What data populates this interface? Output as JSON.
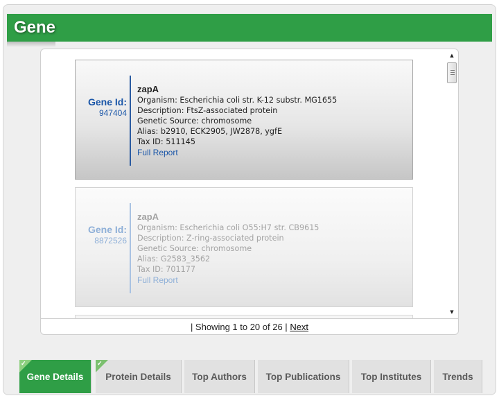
{
  "header": {
    "title": "Gene"
  },
  "results": [
    {
      "id_label": "Gene Id:",
      "id_value": "947404",
      "name": "zapA",
      "organism": "Organism: Escherichia coli str. K-12 substr. MG1655",
      "description": "Description: FtsZ-associated protein",
      "source": "Genetic Source: chromosome",
      "alias": "Alias: b2910, ECK2905, JW2878, ygfE",
      "tax": "Tax ID: 511145",
      "report": "Full Report"
    },
    {
      "id_label": "Gene Id:",
      "id_value": "8872526",
      "name": "zapA",
      "organism": "Organism: Escherichia coli O55:H7 str. CB9615",
      "description": "Description: Z-ring-associated protein",
      "source": "Genetic Source: chromosome",
      "alias": "Alias: G2583_3562",
      "tax": "Tax ID: 701177",
      "report": "Full Report"
    }
  ],
  "pager": {
    "status": "| Showing 1 to 20 of 26 |",
    "next": "Next"
  },
  "tabs": [
    {
      "label": "Gene Details",
      "selected": true,
      "checked": true
    },
    {
      "label": "Protein Details",
      "selected": false,
      "checked": true
    },
    {
      "label": "Top Authors",
      "selected": false,
      "checked": false
    },
    {
      "label": "Top Publications",
      "selected": false,
      "checked": false
    },
    {
      "label": "Top Institutes",
      "selected": false,
      "checked": false
    },
    {
      "label": "Trends",
      "selected": false,
      "checked": false
    }
  ],
  "colors": {
    "brand_green": "#2f9e46",
    "link_blue": "#1a56a8"
  },
  "icons": {
    "check": "check-icon",
    "scroll_up": "arrow-up-icon",
    "scroll_down": "arrow-down-icon"
  }
}
